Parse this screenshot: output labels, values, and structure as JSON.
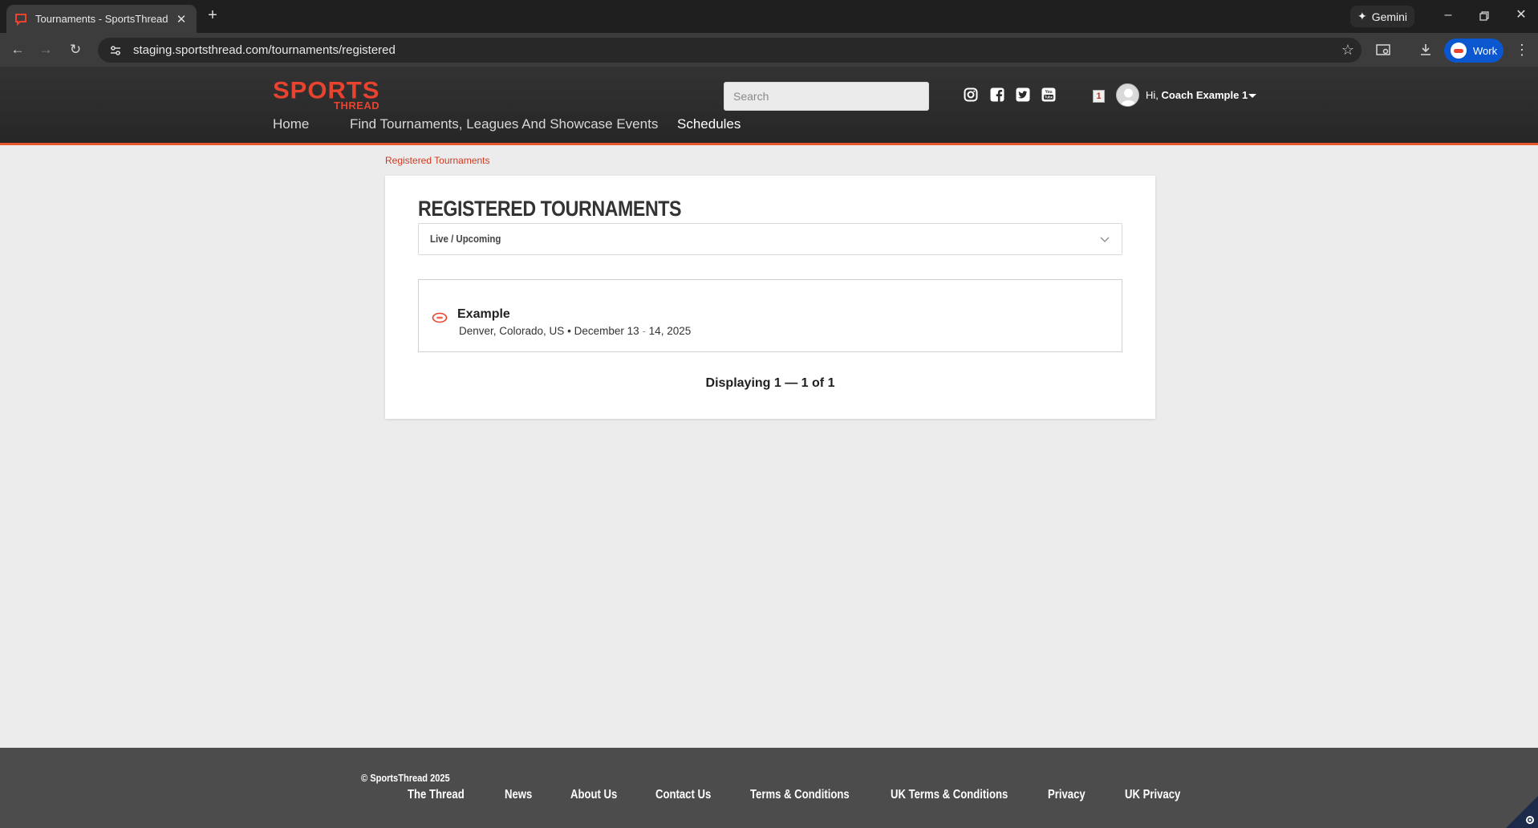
{
  "browser": {
    "tab_title": "Tournaments - SportsThread",
    "new_tab": "+",
    "close_tab": "✕",
    "gemini_label": "Gemini",
    "url": "staging.sportsthread.com/tournaments/registered",
    "profile_label": "Work"
  },
  "site": {
    "logo_main": "SPORTS",
    "logo_sub": "THREAD",
    "search_placeholder": "Search",
    "notification_count": "1",
    "greeting_prefix": "Hi,",
    "user_name": "Coach Example 1",
    "nav": {
      "home": "Home",
      "find": "Find Tournaments, Leagues And Showcase Events",
      "schedules": "Schedules"
    }
  },
  "content": {
    "breadcrumb": "Registered Tournaments",
    "title": "REGISTERED TOURNAMENTS",
    "filter_value": "Live / Upcoming",
    "events": [
      {
        "name": "Example",
        "location": "Denver, Colorado, US",
        "separator": "•",
        "dates_start": "December 13",
        "dates_sep": "-",
        "dates_end": "14, 2025"
      }
    ],
    "pagination": "Displaying 1 — 1 of 1"
  },
  "footer": {
    "copyright": "© SportsThread 2025",
    "links": [
      "The Thread",
      "News",
      "About Us",
      "Contact Us",
      "Terms & Conditions",
      "UK Terms & Conditions",
      "Privacy",
      "UK Privacy"
    ]
  },
  "colors": {
    "brand": "#e8432e",
    "header_bg": "#2b2b2b",
    "footer_bg": "#4c4c4c",
    "profile_chip": "#0b57d0"
  }
}
